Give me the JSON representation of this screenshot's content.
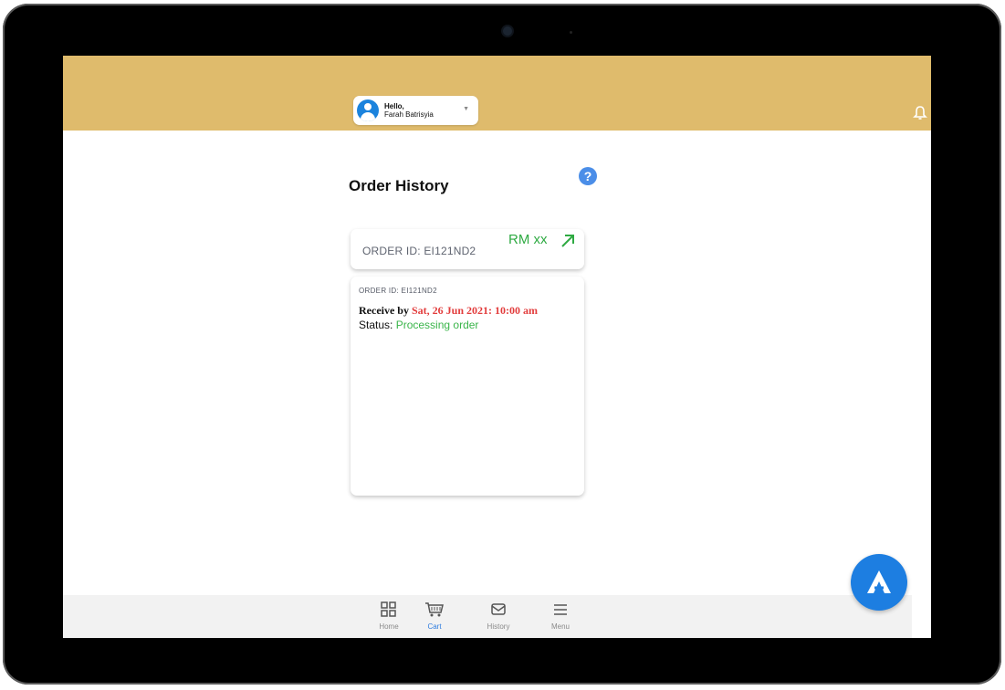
{
  "header": {
    "greeting": "Hello,",
    "user_name": "Farah Batrisyia"
  },
  "page": {
    "title": "Order History",
    "help_label": "?"
  },
  "order_summary": {
    "order_id_label": "ORDER ID: EI121ND2",
    "amount": "RM xx"
  },
  "order_detail": {
    "order_id_label": "ORDER ID: EI121ND2",
    "receive_label": "Receive by",
    "receive_date": "Sat, 26 Jun 2021: 10:00 am",
    "status_label": "Status:",
    "status_value": "Processing order"
  },
  "nav": {
    "items": [
      {
        "label": "Home",
        "icon": "grid-icon"
      },
      {
        "label": "Cart",
        "icon": "cart-icon"
      },
      {
        "label": "History",
        "icon": "mail-icon"
      },
      {
        "label": "Menu",
        "icon": "menu-icon"
      }
    ]
  },
  "colors": {
    "header": "#dfbb6c",
    "accent": "#2f7ddf",
    "amount_green": "#2eaa42",
    "status_green": "#3ab54a",
    "date_red": "#e23c3c"
  }
}
